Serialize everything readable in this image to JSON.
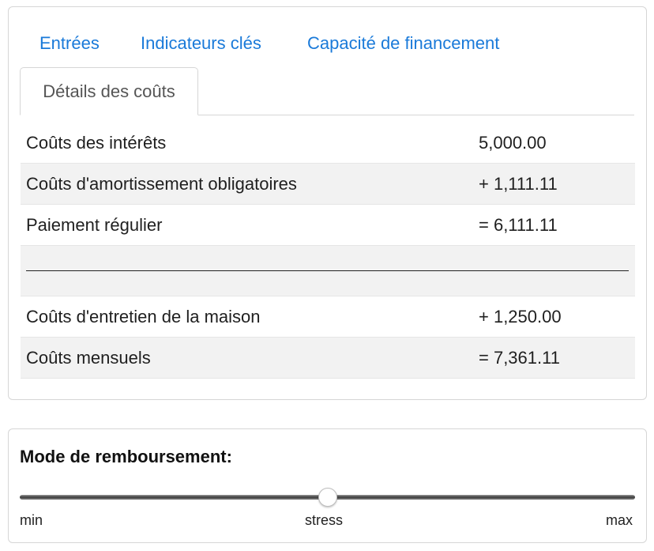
{
  "tabs": {
    "items": [
      {
        "label": "Entrées"
      },
      {
        "label": "Indicateurs clés"
      },
      {
        "label": "Capacité de financement"
      }
    ],
    "active": {
      "label": "Détails des coûts"
    }
  },
  "cost_details": {
    "rows": [
      {
        "label": "Coûts des intérêts",
        "value": "5,000.00"
      },
      {
        "label": "Coûts d'amortissement obligatoires",
        "value": "+ 1,111.11"
      },
      {
        "label": "Paiement régulier",
        "value": "= 6,111.11"
      },
      {
        "label": "Coûts d'entretien de la maison",
        "value": "+ 1,250.00"
      },
      {
        "label": "Coûts mensuels",
        "value": "= 7,361.11"
      }
    ]
  },
  "repayment": {
    "title": "Mode de remboursement:",
    "min_label": "min",
    "mid_label": "stress",
    "max_label": "max",
    "value_fraction": 0.5
  },
  "colors": {
    "link": "#1a7ad9",
    "stripe": "#f2f2f2",
    "border": "#d6d6d6"
  }
}
